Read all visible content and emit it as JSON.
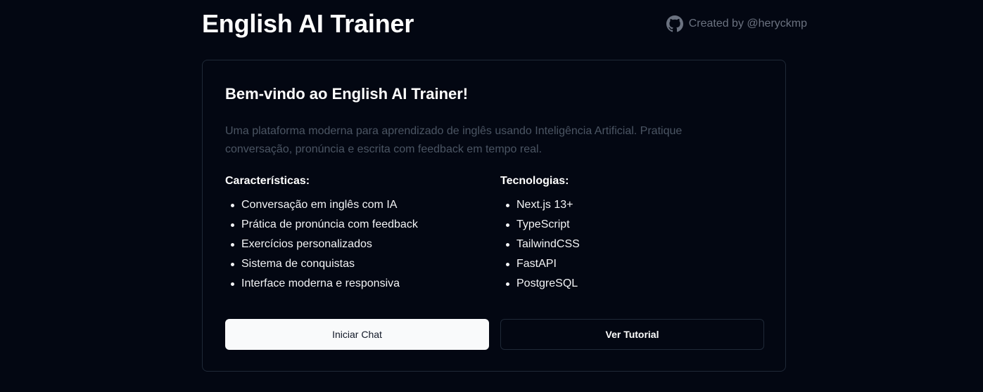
{
  "header": {
    "title": "English AI Trainer",
    "credit": "Created by @heryckmp",
    "credit_icon": "github-icon"
  },
  "card": {
    "title": "Bem-vindo ao English AI Trainer!",
    "description": "Uma plataforma moderna para aprendizado de inglês usando Inteligência Artificial. Pratique conversação, pronúncia e escrita com feedback em tempo real.",
    "features": {
      "heading": "Características:",
      "items": [
        "Conversação em inglês com IA",
        "Prática de pronúncia com feedback",
        "Exercícios personalizados",
        "Sistema de conquistas",
        "Interface moderna e responsiva"
      ]
    },
    "technologies": {
      "heading": "Tecnologias:",
      "items": [
        "Next.js 13+",
        "TypeScript",
        "TailwindCSS",
        "FastAPI",
        "PostgreSQL"
      ]
    },
    "buttons": {
      "primary": "Iniciar Chat",
      "secondary": "Ver Tutorial"
    }
  },
  "colors": {
    "background": "#030712",
    "card_border": "#1f2937",
    "muted_text": "#4b5563",
    "primary_button_bg": "#f9fafb"
  }
}
